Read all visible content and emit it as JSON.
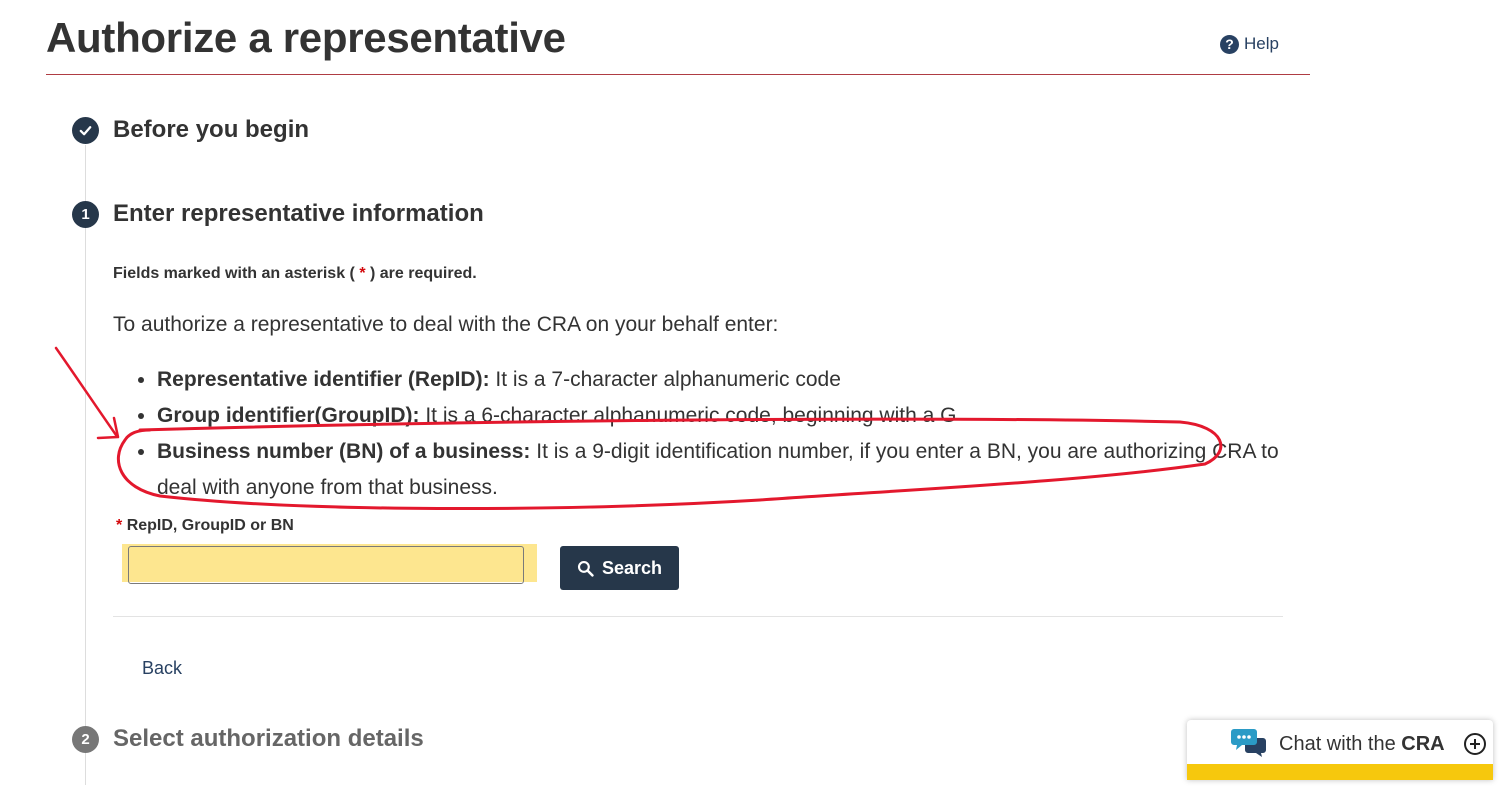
{
  "page": {
    "title": "Authorize a representative",
    "help_label": "Help"
  },
  "steps": [
    {
      "marker": "✓",
      "title": "Before you begin",
      "state": "complete"
    },
    {
      "marker": "1",
      "title": "Enter representative information",
      "state": "current"
    },
    {
      "marker": "2",
      "title": "Select authorization details",
      "state": "upcoming"
    }
  ],
  "form": {
    "required_note_pre": "Fields marked with an asterisk ( ",
    "required_star": "*",
    "required_note_post": " ) are required.",
    "intro": "To authorize a representative to deal with the CRA on your behalf enter:",
    "bullets": [
      {
        "term": "Representative identifier (RepID):",
        "text": " It is a 7-character alphanumeric code"
      },
      {
        "term": "Group identifier(GroupID):",
        "text": " It is a 6-character alphanumeric code, beginning with a G"
      },
      {
        "term": "Business number (BN) of a business:",
        "text": " It is a 9-digit identification number, if you enter a BN, you are authorizing CRA to deal with anyone from that business."
      }
    ],
    "field_star": "*",
    "field_label": "RepID, GroupID or BN",
    "field_value": "",
    "search_label": "Search",
    "back_label": "Back"
  },
  "chat": {
    "label_pre": "Chat with the ",
    "label_bold": "CRA"
  },
  "colors": {
    "primary": "#26374a",
    "accent_rule": "#af3c43",
    "required": "#d3080c",
    "chat_bar": "#f6c80d",
    "highlight": "#fde68f",
    "annotation": "#e3182d"
  },
  "icons": [
    "help-icon",
    "check-icon",
    "search-icon",
    "chat-bubbles-icon",
    "plus-circle-icon"
  ]
}
